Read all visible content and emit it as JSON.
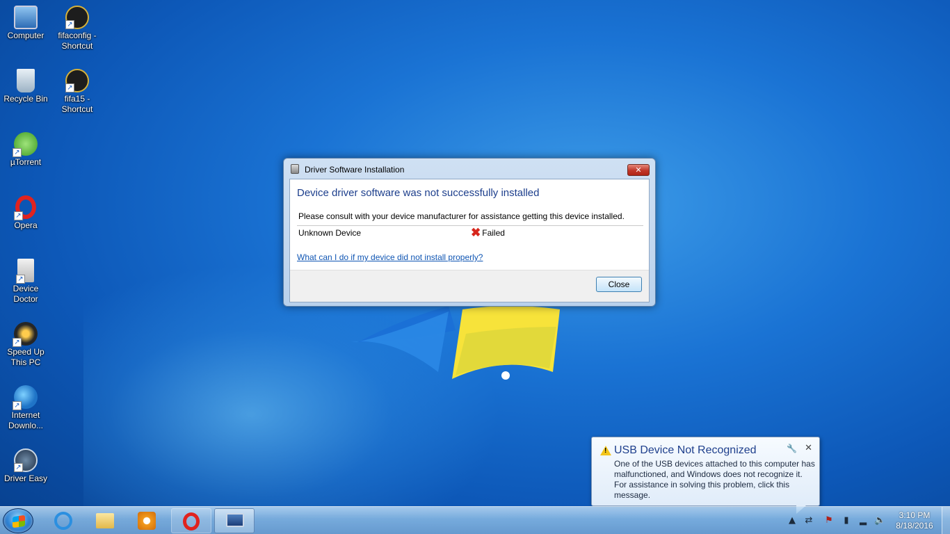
{
  "desktop": {
    "icons": [
      {
        "label": "Computer",
        "icon": "computer-icon"
      },
      {
        "label": "fifaconfig - Shortcut",
        "icon": "fifa15-icon"
      },
      {
        "label": "Recycle Bin",
        "icon": "recycle-bin-icon"
      },
      {
        "label": "fifa15 - Shortcut",
        "icon": "fifa15-icon"
      },
      {
        "label": "µTorrent",
        "icon": "utorrent-icon"
      },
      {
        "label": "Opera",
        "icon": "opera-icon"
      },
      {
        "label": "Device Doctor",
        "icon": "device-doctor-icon"
      },
      {
        "label": "Speed Up This PC",
        "icon": "speed-up-icon"
      },
      {
        "label": "Internet Downlo...",
        "icon": "internet-download-manager-icon"
      },
      {
        "label": "Driver Easy",
        "icon": "driver-easy-icon"
      }
    ]
  },
  "dialog": {
    "title": "Driver Software Installation",
    "close_glyph": "✕",
    "heading": "Device driver software was not successfully installed",
    "message": "Please consult with your device manufacturer for assistance getting this device installed.",
    "device_name": "Unknown Device",
    "status": "Failed",
    "help_link": "What can I do if my device did not install properly?",
    "close_button": "Close"
  },
  "notification": {
    "title": "USB Device Not Recognized",
    "message": "One of the USB devices attached to this computer has malfunctioned, and Windows does not recognize it. For assistance in solving this problem, click this message.",
    "close_glyph": "✕"
  },
  "taskbar": {
    "pinned": [
      {
        "name": "internet-explorer",
        "icon": "internet-explorer-icon"
      },
      {
        "name": "windows-explorer",
        "icon": "folder-icon"
      },
      {
        "name": "media-player",
        "icon": "media-player-icon"
      },
      {
        "name": "opera",
        "icon": "opera-icon"
      },
      {
        "name": "driver-installation",
        "icon": "device-installation-icon"
      }
    ],
    "clock": {
      "time": "3:10 PM",
      "date": "8/18/2016"
    }
  },
  "colors": {
    "heading": "#1c3e8c",
    "link": "#0f55b3",
    "failed": "#d7261c",
    "warning": "#f3c51b"
  }
}
